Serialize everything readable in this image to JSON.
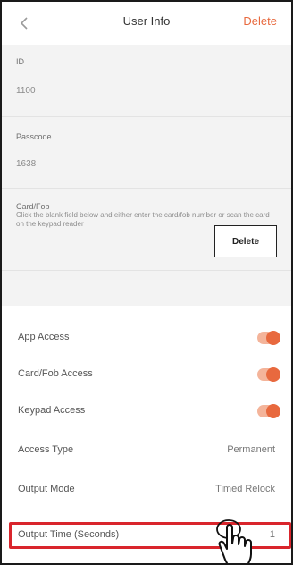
{
  "header": {
    "back_icon": "chevron-left-icon",
    "title": "User Info",
    "delete_label": "Delete"
  },
  "fields": {
    "id_label": "ID",
    "id_value": "1100",
    "passcode_label": "Passcode",
    "passcode_value": "1638",
    "card_label": "Card/Fob",
    "card_hint": "Click the blank field below and either enter the card/fob number or scan the card on the keypad reader",
    "card_delete_label": "Delete"
  },
  "settings": [
    {
      "label": "App Access",
      "type": "toggle",
      "on": true
    },
    {
      "label": "Card/Fob Access",
      "type": "toggle",
      "on": true
    },
    {
      "label": "Keypad Access",
      "type": "toggle",
      "on": true
    },
    {
      "label": "Access Type",
      "type": "value",
      "value": "Permanent"
    },
    {
      "label": "Output Mode",
      "type": "value",
      "value": "Timed Relock"
    },
    {
      "label": "Output Time (Seconds)",
      "type": "value",
      "value": "1"
    }
  ],
  "colors": {
    "accent": "#e8693e",
    "highlight": "#d9252c"
  },
  "overlay_icon": "hand-pointer-icon"
}
